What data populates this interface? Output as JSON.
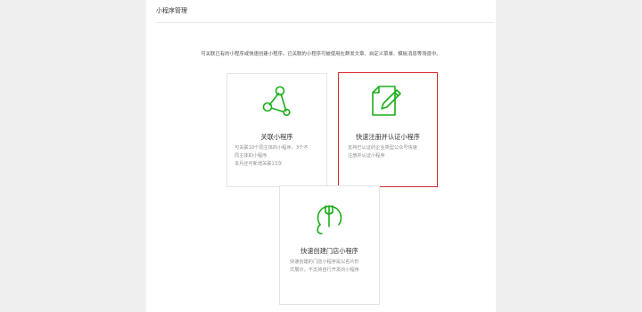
{
  "header": {
    "title": "小程序管理"
  },
  "intro": "可关联已有的小程序或快速创建小程序。已关联的小程序可被使用在群发文章、自定义菜单、模板消息等场景中。",
  "cards": {
    "link": {
      "title": "关联小程序",
      "icon": "share-nodes-icon",
      "desc": [
        "可关联10个同主体的小程序，3个不",
        "同主体的小程序",
        "本月还可新增关联13次"
      ]
    },
    "register": {
      "title": "快速注册并认证小程序",
      "icon": "document-edit-icon",
      "desc": [
        "支持已认证的企业类型公众号快速",
        "注册并认证小程序"
      ]
    },
    "store": {
      "title": "快速创建门店小程序",
      "icon": "store-fork-icon",
      "desc": [
        "快速创建的门店小程序是以名片形",
        "式展示，不支持自行开发的小程序"
      ]
    }
  },
  "colors": {
    "accent": "#1aad19",
    "selected_border": "#d5292b",
    "background": "#efefef"
  }
}
